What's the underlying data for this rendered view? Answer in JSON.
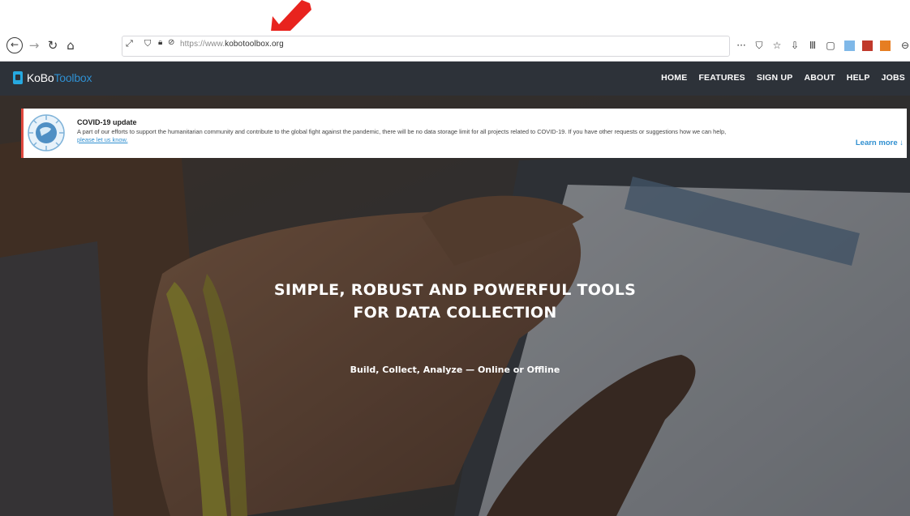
{
  "browser": {
    "url_prefix": "https://www.",
    "url_domain": "kobotoolbox.org",
    "toolbar_icons": [
      "more-icon",
      "pocket-icon",
      "star-icon",
      "downloads-icon",
      "library-icon",
      "sidebar-icon",
      "reader-icon",
      "extension-red-icon",
      "extension-orange-icon",
      "account-icon",
      "overflow-icon"
    ],
    "toolbar_glyphs": [
      "···",
      "⛉",
      "☆",
      "⇩",
      "Ⅲ",
      "▢",
      "",
      "",
      "",
      "⊖",
      "»"
    ]
  },
  "site": {
    "logo_text_1": "KoBo",
    "logo_text_2": "Toolbox",
    "nav": [
      "HOME",
      "FEATURES",
      "SIGN UP",
      "ABOUT",
      "HELP",
      "JOBS"
    ]
  },
  "banner": {
    "title": "COVID-19 update",
    "body": "A part of our efforts to support the humanitarian community and contribute to the global fight against the pandemic, there will be no data storage limit for all projects related to COVID-19. If you have other requests or suggestions how we can help,",
    "link": "please let us know.",
    "learn_more": "Learn more ↓"
  },
  "hero": {
    "headline_line1": "SIMPLE, ROBUST AND POWERFUL TOOLS",
    "headline_line2": "FOR DATA COLLECTION",
    "subtitle": "Build, Collect, Analyze — Online or Offline"
  },
  "colors": {
    "nav_bg": "#2d3239",
    "brand_blue": "#2f8fd0",
    "banner_accent": "#e0483e",
    "arrow_red": "#e8231e"
  }
}
